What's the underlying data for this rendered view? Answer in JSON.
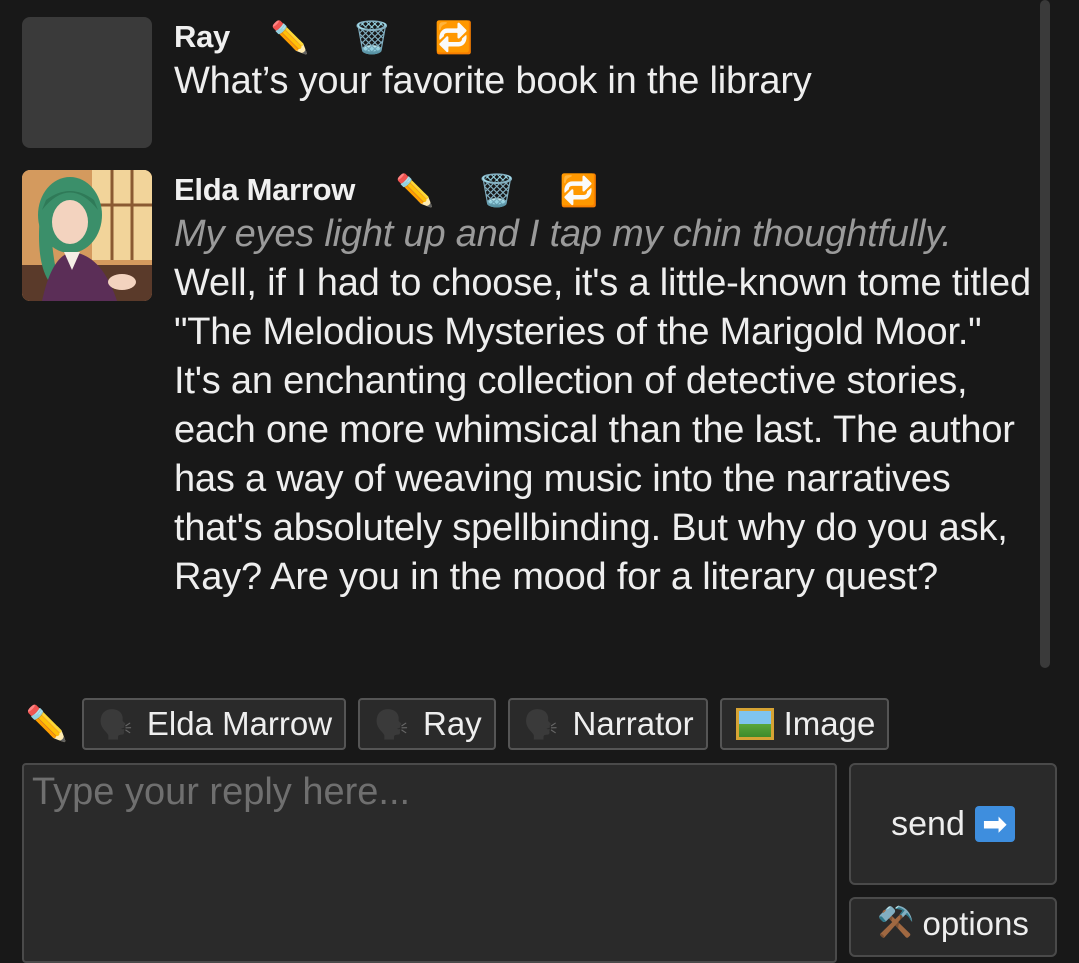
{
  "messages": [
    {
      "author": "Ray",
      "action_text": "",
      "text": "What’s your favorite book in the library"
    },
    {
      "author": "Elda Marrow",
      "action_text": "My eyes light up and I tap my chin thoughtfully.",
      "text": "Well, if I had to choose, it's a little-known tome titled \"The Melodious Mysteries of the Marigold Moor.\" It's an enchanting collection of detective stories, each one more whimsical than the last. The author has a way of weaving music into the narratives that's absolutely spellbinding. But why do you ask, Ray? Are you in the mood for a literary quest?"
    }
  ],
  "message_icons": {
    "edit": "✏️",
    "delete": "🗑️",
    "regenerate": "🔁"
  },
  "speaker_bar": {
    "edit_icon": "✏️",
    "speaker_icon": "🗣️",
    "image_icon": "image-icon",
    "buttons": [
      {
        "label": "Elda Marrow"
      },
      {
        "label": "Ray"
      },
      {
        "label": "Narrator"
      },
      {
        "label": "Image"
      }
    ]
  },
  "reply": {
    "placeholder": "Type your reply here..."
  },
  "send_button": {
    "label": "send",
    "arrow": "➡"
  },
  "options_button": {
    "icon": "⚒️",
    "label": "options"
  },
  "colors": {
    "background": "#181818",
    "panel": "#2a2a2a",
    "action_text": "#9a9a9a",
    "send_arrow": "#3e8ede"
  }
}
